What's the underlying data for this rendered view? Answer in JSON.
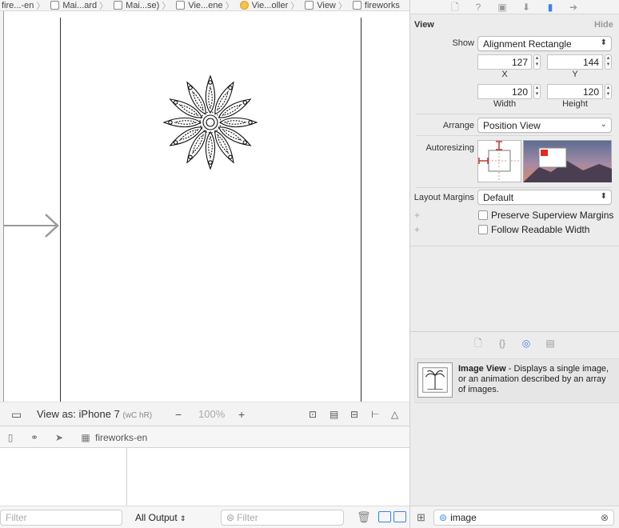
{
  "breadcrumbs": [
    "fire...-en",
    "Mai...ard",
    "Mai...se)",
    "Vie...ene",
    "Vie...oller",
    "View",
    "fireworks"
  ],
  "canvas": {
    "view_as_label": "View as: iPhone 7",
    "view_as_size": "(wC hR)",
    "zoom_level": "100%"
  },
  "debug": {
    "target": "fireworks-en"
  },
  "console": {
    "filter_placeholder_left": "Filter",
    "output_selector": "All Output",
    "filter_placeholder_right": "Filter"
  },
  "inspector": {
    "section_title": "View",
    "hide_label": "Hide",
    "show_label": "Show",
    "show_value": "Alignment Rectangle",
    "x_value": "127",
    "y_value": "144",
    "x_caption": "X",
    "y_caption": "Y",
    "width_value": "120",
    "height_value": "120",
    "width_caption": "Width",
    "height_caption": "Height",
    "arrange_label": "Arrange",
    "arrange_value": "Position View",
    "autoresizing_label": "Autoresizing",
    "layout_margins_label": "Layout Margins",
    "layout_margins_value": "Default",
    "preserve_label": "Preserve Superview Margins",
    "follow_label": "Follow Readable Width"
  },
  "library": {
    "item_title": "Image View",
    "item_description": " - Displays a single image, or an animation described by an array of images.",
    "search_value": "image"
  },
  "colors": {
    "accent": "#3a82f7",
    "autoresize_red": "#c0392b"
  }
}
